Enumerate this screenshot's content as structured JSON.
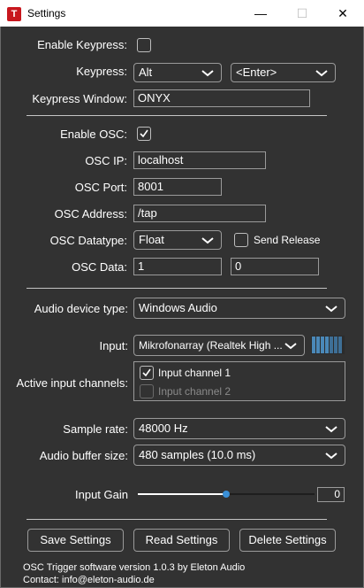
{
  "window": {
    "title": "Settings",
    "logo_letter": "T",
    "minimize_glyph": "—",
    "maximize_glyph": "☐",
    "close_glyph": "✕"
  },
  "keypress": {
    "enable_label": "Enable Keypress:",
    "enabled": false,
    "keypress_label": "Keypress:",
    "modifier": "Alt",
    "key": "<Enter>",
    "window_label": "Keypress Window:",
    "window_value": "ONYX"
  },
  "osc": {
    "enable_label": "Enable OSC:",
    "enabled": true,
    "ip_label": "OSC IP:",
    "ip_value": "localhost",
    "port_label": "OSC Port:",
    "port_value": "8001",
    "address_label": "OSC Address:",
    "address_value": "/tap",
    "datatype_label": "OSC Datatype:",
    "datatype_value": "Float",
    "send_release_label": "Send Release",
    "send_release": false,
    "data_label": "OSC Data:",
    "data_value_1": "1",
    "data_value_2": "0"
  },
  "audio": {
    "device_type_label": "Audio device type:",
    "device_type_value": "Windows Audio",
    "input_label": "Input:",
    "input_value": "Mikrofonarray (Realtek High ...",
    "active_channels_label": "Active input channels:",
    "channels": [
      {
        "label": "Input channel 1",
        "checked": true
      },
      {
        "label": "Input channel 2",
        "checked": false
      }
    ],
    "sample_rate_label": "Sample rate:",
    "sample_rate_value": "48000 Hz",
    "buffer_label": "Audio buffer size:",
    "buffer_value": "480 samples (10.0 ms)",
    "gain_label": "Input Gain",
    "gain_value": "0",
    "gain_fraction": 0.5
  },
  "buttons": {
    "save": "Save Settings",
    "read": "Read Settings",
    "delete": "Delete Settings"
  },
  "footer": {
    "version": "OSC Trigger software version 1.0.3 by Eleton Audio",
    "contact": "Contact: info@eleton-audio.de"
  },
  "colors": {
    "background": "#323232",
    "slider_accent": "#3a8fd6",
    "logo_red": "#c8171e"
  }
}
